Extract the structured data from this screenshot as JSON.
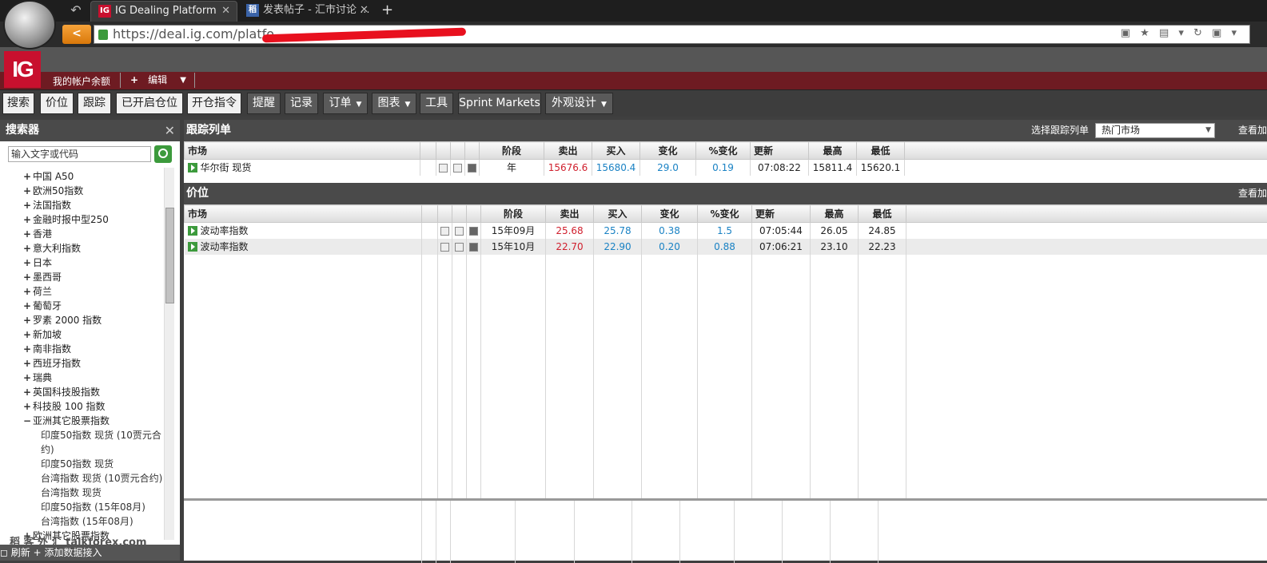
{
  "browser": {
    "tabs": [
      {
        "icon": "IG",
        "title": "IG Dealing Platform",
        "close": "✕"
      },
      {
        "icon": "稻",
        "title": "发表帖子 - 汇市讨论 ...",
        "close": "✕"
      }
    ],
    "new_tab": "+",
    "back_glyph": "↶",
    "url": "https://deal.ig.com/platfo",
    "back_btn": "<",
    "url_icons": "▣ ★ ▤ ▾ ↻ ▣ ▾"
  },
  "ig": {
    "logo": "IG",
    "account": "我的帐户余额",
    "edit": "编辑",
    "edit_plus": "+",
    "edit_caret": "▼"
  },
  "toolbar": {
    "items": [
      "搜索",
      "价位",
      "跟踪",
      "已开启仓位",
      "开仓指令",
      "提醒",
      "记录",
      "订单",
      "图表",
      "工具",
      "Sprint Markets",
      "外观设计"
    ],
    "dropdown": "▼"
  },
  "sidebar": {
    "title": "搜索器",
    "close": "✕",
    "search_placeholder": "输入文字或代码",
    "items": [
      {
        "pm": "+",
        "label": "中国 A50"
      },
      {
        "pm": "+",
        "label": "欧洲50指数"
      },
      {
        "pm": "+",
        "label": "法国指数"
      },
      {
        "pm": "+",
        "label": "金融时报中型250"
      },
      {
        "pm": "+",
        "label": "香港"
      },
      {
        "pm": "+",
        "label": "意大利指数"
      },
      {
        "pm": "+",
        "label": "日本"
      },
      {
        "pm": "+",
        "label": "墨西哥"
      },
      {
        "pm": "+",
        "label": "荷兰"
      },
      {
        "pm": "+",
        "label": "葡萄牙"
      },
      {
        "pm": "+",
        "label": "罗素 2000 指数"
      },
      {
        "pm": "+",
        "label": "新加坡"
      },
      {
        "pm": "+",
        "label": "南非指数"
      },
      {
        "pm": "+",
        "label": "西班牙指数"
      },
      {
        "pm": "+",
        "label": "瑞典"
      },
      {
        "pm": "+",
        "label": "英国科技股指数"
      },
      {
        "pm": "+",
        "label": "科技股 100 指数"
      },
      {
        "pm": "−",
        "label": "亚洲其它股票指数"
      }
    ],
    "subitems": [
      "印度50指数 现货 (10贾元合",
      "约)",
      "印度50指数 现货",
      "台湾指数 现货 (10贾元合约)",
      "台湾指数 现货",
      "印度50指数 (15年08月)",
      "台湾指数 (15年08月)"
    ],
    "last_item": {
      "pm": "+",
      "label": "欧洲其它股票指数"
    },
    "footer": "◻ 刷新   + 添加数据接入"
  },
  "watermark": "稻 客 外 汇  talkforex.com",
  "watchlist": {
    "title": "跟踪列单",
    "select_label": "选择跟踪列单",
    "selected": "热门市场",
    "caret": "▼",
    "view_all": "查看加",
    "columns": [
      "市场",
      "阶段",
      "卖出",
      "买入",
      "变化",
      "%变化",
      "更新",
      "最高",
      "最低"
    ],
    "rows": [
      {
        "market": "华尔街 现货",
        "period": "年",
        "sell": "15676.6",
        "buy": "15680.4",
        "change": "29.0",
        "pct": "0.19",
        "time": "07:08:22",
        "high": "15811.4",
        "low": "15620.1"
      }
    ]
  },
  "prices": {
    "title": "价位",
    "view_all": "查看加",
    "columns": [
      "市场",
      "阶段",
      "卖出",
      "买入",
      "变化",
      "%变化",
      "更新",
      "最高",
      "最低"
    ],
    "rows": [
      {
        "market": "波动率指数",
        "period": "15年09月",
        "sell": "25.68",
        "buy": "25.78",
        "change": "0.38",
        "pct": "1.5",
        "time": "07:05:44",
        "high": "26.05",
        "low": "24.85"
      },
      {
        "market": "波动率指数",
        "period": "15年10月",
        "sell": "22.70",
        "buy": "22.90",
        "change": "0.20",
        "pct": "0.88",
        "time": "07:06:21",
        "high": "23.10",
        "low": "22.23"
      }
    ]
  },
  "colors": {
    "accent": "#c8102e",
    "sell": "#d0202e",
    "buy": "#1a82c4",
    "header": "#4a4a4a"
  }
}
